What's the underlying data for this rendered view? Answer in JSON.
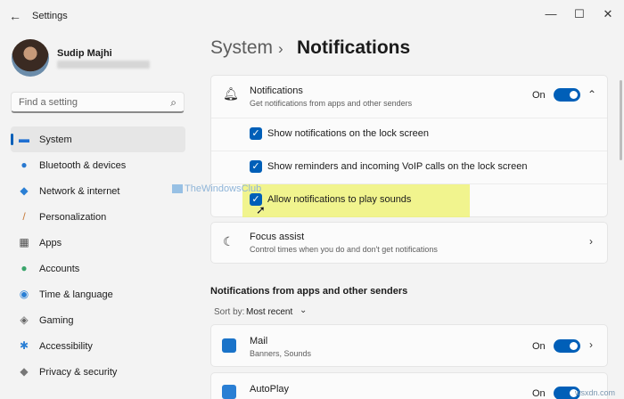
{
  "window": {
    "title": "Settings",
    "controls": [
      "—",
      "☐",
      "✕"
    ]
  },
  "user": {
    "name": "Sudip Majhi"
  },
  "search": {
    "placeholder": "Find a setting"
  },
  "sidebar": {
    "items": [
      {
        "label": "System",
        "icon": "monitor-icon",
        "glyph": "▬",
        "color": "#1f6fd1",
        "active": true
      },
      {
        "label": "Bluetooth & devices",
        "icon": "bluetooth-icon",
        "glyph": "●",
        "color": "#2878d0",
        "active": false
      },
      {
        "label": "Network & internet",
        "icon": "wifi-icon",
        "glyph": "◆",
        "color": "#2a7fd4",
        "active": false
      },
      {
        "label": "Personalization",
        "icon": "brush-icon",
        "glyph": "/",
        "color": "#c77b3a",
        "active": false
      },
      {
        "label": "Apps",
        "icon": "apps-icon",
        "glyph": "▦",
        "color": "#4a4a4a",
        "active": false
      },
      {
        "label": "Accounts",
        "icon": "person-icon",
        "glyph": "●",
        "color": "#3aa56b",
        "active": false
      },
      {
        "label": "Time & language",
        "icon": "globe-clock-icon",
        "glyph": "◉",
        "color": "#2a7fd4",
        "active": false
      },
      {
        "label": "Gaming",
        "icon": "controller-icon",
        "glyph": "◈",
        "color": "#666666",
        "active": false
      },
      {
        "label": "Accessibility",
        "icon": "accessibility-icon",
        "glyph": "✱",
        "color": "#2a7fd4",
        "active": false
      },
      {
        "label": "Privacy & security",
        "icon": "shield-icon",
        "glyph": "◆",
        "color": "#777777",
        "active": false
      }
    ]
  },
  "breadcrumb": {
    "parent": "System",
    "separator": "›",
    "current": "Notifications"
  },
  "notifications": {
    "title": "Notifications",
    "subtitle": "Get notifications from apps and other senders",
    "state": "On",
    "on": true,
    "options": [
      {
        "label": "Show notifications on the lock screen",
        "checked": true
      },
      {
        "label": "Show reminders and incoming VoIP calls on the lock screen",
        "checked": true
      },
      {
        "label": "Allow notifications to play sounds",
        "checked": true
      }
    ]
  },
  "focus_assist": {
    "title": "Focus assist",
    "subtitle": "Control times when you do and don't get notifications"
  },
  "apps_section": {
    "title": "Notifications from apps and other senders",
    "sort_label": "Sort by:",
    "sort_value": "Most recent",
    "apps": [
      {
        "name": "Mail",
        "detail": "Banners, Sounds",
        "state": "On",
        "on": true,
        "icon": "mail-icon",
        "color": "#1a73c9"
      },
      {
        "name": "AutoPlay",
        "detail": "",
        "state": "On",
        "on": true,
        "icon": "autoplay-icon",
        "color": "#2a7fd4"
      }
    ]
  },
  "watermark": {
    "text": "TheWindowsClub",
    "site": "wsxdn.com"
  },
  "colors": {
    "accent": "#005fb8",
    "highlight": "#eef27a"
  }
}
